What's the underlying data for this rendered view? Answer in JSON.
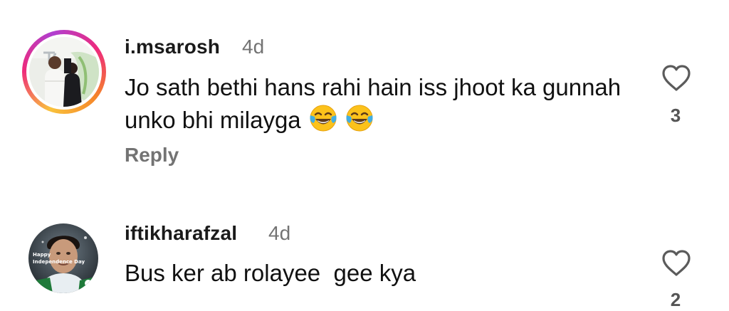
{
  "comments": [
    {
      "username": "i.msarosh",
      "time": "4d",
      "text": "Jo sath bethi hans rahi hain iss jhoot ka gunnah unko bhi milayga",
      "emojis": [
        "face-with-tears-of-joy-icon",
        "face-with-tears-of-joy-icon"
      ],
      "reply_label": "Reply",
      "likes": "3",
      "avatar_has_story_ring": true
    },
    {
      "username": "iftikharafzal",
      "time": "4d",
      "text": "Bus ker ab rolayee  gee kya",
      "likes": "2",
      "avatar_overlay_line1": "Happy",
      "avatar_overlay_line2": "Independence Day"
    }
  ],
  "colors": {
    "username": "#1a1a1a",
    "muted": "#737373",
    "text": "#111111",
    "story_ring": [
      "#f9c23c",
      "#ee2a7b",
      "#b03fd1"
    ]
  }
}
